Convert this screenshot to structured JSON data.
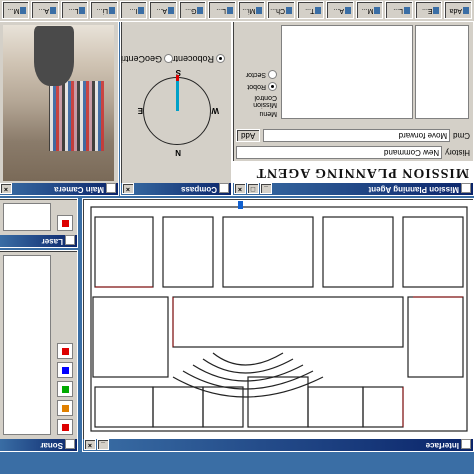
{
  "taskbar": {
    "items": [
      "Ada",
      "E...",
      "L...",
      "M...",
      "A...",
      "T...",
      "Ch...",
      "Mi...",
      "L...",
      "G...",
      "A...",
      "I...",
      "Li...",
      "L...",
      "A...",
      "M..."
    ]
  },
  "mission": {
    "title": "Mission Planning Agent",
    "header": "MISSION PLANNING AGENT",
    "history_label": "History",
    "new_command_label": "New Command",
    "command_label": "Cmd",
    "command_value": "Move forward",
    "add_label": "Add",
    "side": {
      "menu_label": "Menu",
      "mission_control": "Mission Control",
      "robot_label": "Robot",
      "radio_a": "Robot",
      "radio_b": "Sector"
    }
  },
  "compass": {
    "title": "Compass",
    "n": "N",
    "s": "S",
    "e": "E",
    "w": "W",
    "radio_robocentric": "Robocentric",
    "radio_geocentric": "GeoCentric"
  },
  "camera": {
    "title": "Main Camera"
  },
  "map": {
    "title": "Interface"
  },
  "laser": {
    "title": "Laser",
    "label": "Laser"
  },
  "sonar": {
    "title": "Sonar",
    "label": "Sonar"
  },
  "colors": {
    "titlebar": "#0a246a",
    "desktop": "#3a6ea5",
    "needle": "#00a0c8"
  }
}
